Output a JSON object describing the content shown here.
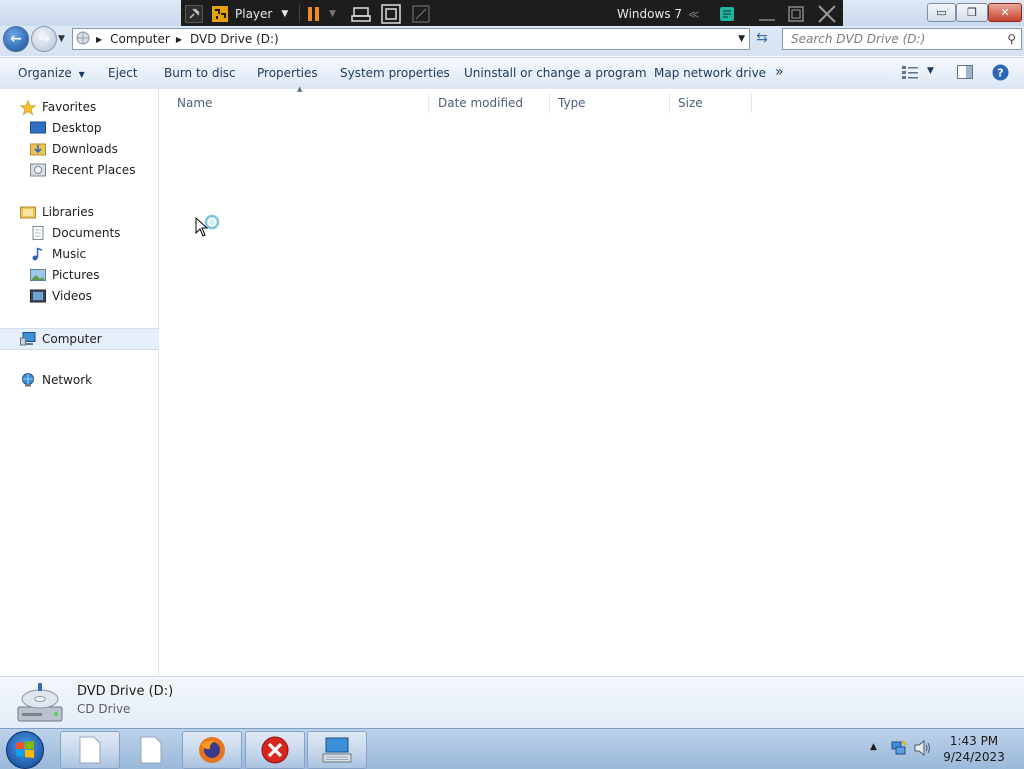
{
  "vmware": {
    "player_label": "Player",
    "vm_name": "Windows 7"
  },
  "window_controls": {
    "minimize": "▭",
    "maximize": "❐",
    "close": "✕"
  },
  "address": {
    "crumbs": [
      "Computer",
      "DVD Drive (D:)"
    ]
  },
  "search": {
    "placeholder": "Search DVD Drive (D:)"
  },
  "toolbar": {
    "organize": "Organize",
    "eject": "Eject",
    "burn": "Burn to disc",
    "properties": "Properties",
    "system_properties": "System properties",
    "uninstall": "Uninstall or change a program",
    "map_network": "Map network drive",
    "more": "»"
  },
  "sidebar": {
    "favorites": "Favorites",
    "desktop": "Desktop",
    "downloads": "Downloads",
    "recent": "Recent Places",
    "libraries": "Libraries",
    "documents": "Documents",
    "music": "Music",
    "pictures": "Pictures",
    "videos": "Videos",
    "computer": "Computer",
    "network": "Network"
  },
  "columns": [
    "Name",
    "Date modified",
    "Type",
    "Size"
  ],
  "details": {
    "title": "DVD Drive (D:)",
    "subtitle": "CD Drive"
  },
  "tray": {
    "time": "1:43 PM",
    "date": "9/24/2023"
  },
  "colors": {
    "accent": "#1e395b",
    "taskbar": "#a8c2e0",
    "vm_bar": "#1d1d1d"
  }
}
